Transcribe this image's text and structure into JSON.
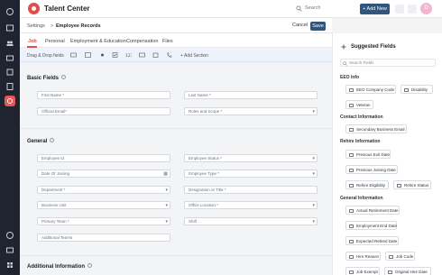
{
  "app": {
    "title": "Talent Center"
  },
  "topbar": {
    "search_placeholder": "Search",
    "add_new_label": "+ Add New",
    "avatar_initial": "D"
  },
  "breadcrumb": {
    "root": "Settings",
    "separator": ">",
    "current": "Employee Records"
  },
  "actions": {
    "cancel_label": "Cancel",
    "save_label": "Save"
  },
  "tabs": [
    "Job",
    "Personal",
    "Employment & Education",
    "Compensation",
    "Files"
  ],
  "drop_bar": {
    "label": "Drag & Drop fields",
    "add_section_label": "+ Add Section"
  },
  "sections": {
    "basic": {
      "title": "Basic Fields",
      "fields": [
        "First Name *",
        "Last Name *",
        "Official Email*",
        "Roles and Scope *"
      ]
    },
    "general": {
      "title": "General",
      "fields": [
        "Employee Id",
        "Employee Status *",
        "Date Of Joining",
        "Employee Type *",
        "Department *",
        "Designation or Title *",
        "Business Unit",
        "Office Location *",
        "Primary Team *",
        "Shift",
        "Additional Teams"
      ]
    },
    "additional": {
      "title": "Additional Information"
    }
  },
  "suggested": {
    "title": "Suggested Fields",
    "search_placeholder": "Search Fields",
    "groups": [
      {
        "label": "EEO Info",
        "chips": [
          "EEO Company Code",
          "Disability",
          "Veteran"
        ]
      },
      {
        "label": "Contact Information",
        "chips": [
          "Secondary Business Email"
        ]
      },
      {
        "label": "Rehire Information",
        "chips": [
          "Previous Exit Date",
          "Previous Joining Date",
          "Rehire Eligibility",
          "Rehire Status"
        ]
      },
      {
        "label": "General Information",
        "chips": [
          "Actual Retirement Date",
          "Employment End Date",
          "Expected Retired Date",
          "Hire Reason",
          "Job Code",
          "Job Exempt",
          "Original Hire Date"
        ]
      }
    ]
  },
  "colors": {
    "accent": "#e04f4f",
    "primary_button": "#31557d",
    "rail": "#1f2430"
  }
}
